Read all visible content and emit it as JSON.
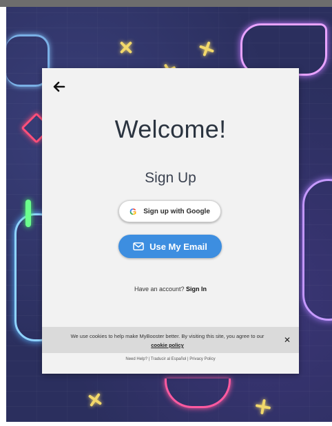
{
  "modal": {
    "title": "Welcome!",
    "subtitle": "Sign Up",
    "google_button_label": "Sign up with Google",
    "email_button_label": "Use My Email",
    "have_account_prefix": "Have an account?",
    "sign_in_link": "Sign In"
  },
  "cookie_banner": {
    "text": "We use cookies to help make MyBooster better. By visiting this site, you agree to our",
    "link_label": "cookie policy",
    "close_icon": "close-icon"
  },
  "footer": {
    "need_help": "Need Help?",
    "separator_1": " | ",
    "translate": "Traducir al Español",
    "separator_2": " | ",
    "privacy": "Privacy Policy"
  },
  "colors": {
    "primary_button": "#3d8ee0",
    "card_background": "#f2f2f2",
    "cookie_bar": "#dadada",
    "background_dark": "#2b2f5e"
  },
  "icons": {
    "back": "arrow-left-icon",
    "google": "google-icon",
    "email": "envelope-icon"
  }
}
